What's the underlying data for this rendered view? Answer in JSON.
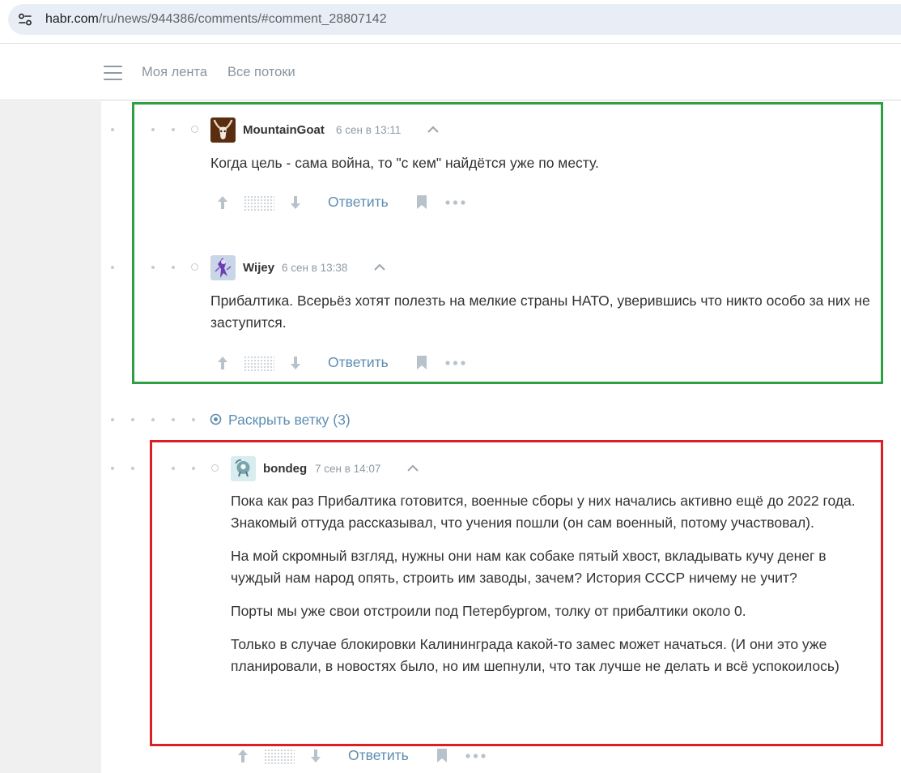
{
  "browser": {
    "url_host": "habr.com",
    "url_path": "/ru/news/944386/comments/#comment_28807142"
  },
  "header": {
    "nav": [
      {
        "label": "Моя лента"
      },
      {
        "label": "Все потоки"
      }
    ]
  },
  "comments": [
    {
      "author": "MountainGoat",
      "time": "6 сен в 13:11",
      "paragraphs": [
        "Когда цель - сама война, то \"с кем\" найдётся уже по месту."
      ],
      "reply_label": "Ответить",
      "avatar_icon": "goat-avatar-icon"
    },
    {
      "author": "Wijey",
      "time": "6 сен в 13:38",
      "paragraphs": [
        "Прибалтика. Всерьёз хотят полезть на мелкие страны НАТО, уверившись что никто особо за них не заступится."
      ],
      "reply_label": "Ответить",
      "avatar_icon": "figure-avatar-icon"
    },
    {
      "author": "bondeg",
      "time": "7 сен в 14:07",
      "paragraphs": [
        "Пока как раз Прибалтика готовится, военные сборы у них начались активно ещё до 2022 года. Знакомый оттуда рассказывал, что учения пошли (он сам военный, потому участвовал).",
        "На мой скромный взгляд, нужны они нам как собаке пятый хвост, вкладывать кучу денег в чуждый нам народ опять, строить им заводы, зачем? История СССР ничему не учит?",
        "Порты мы уже свои отстроили под Петербургом, толку от прибалтики около 0.",
        "Только в случае блокировки Калининграда какой-то замес может начаться. (И они это уже планировали, в новостях было, но им шепнули, что так лучше не делать и всё успокоилось)"
      ],
      "reply_label": "Ответить",
      "avatar_icon": "robot-avatar-icon"
    }
  ],
  "expand_branch": {
    "label": "Раскрыть ветку (3)"
  },
  "colors": {
    "link": "#5e8db0",
    "highlight_green": "#2ea043",
    "highlight_red": "#dc1f26"
  }
}
